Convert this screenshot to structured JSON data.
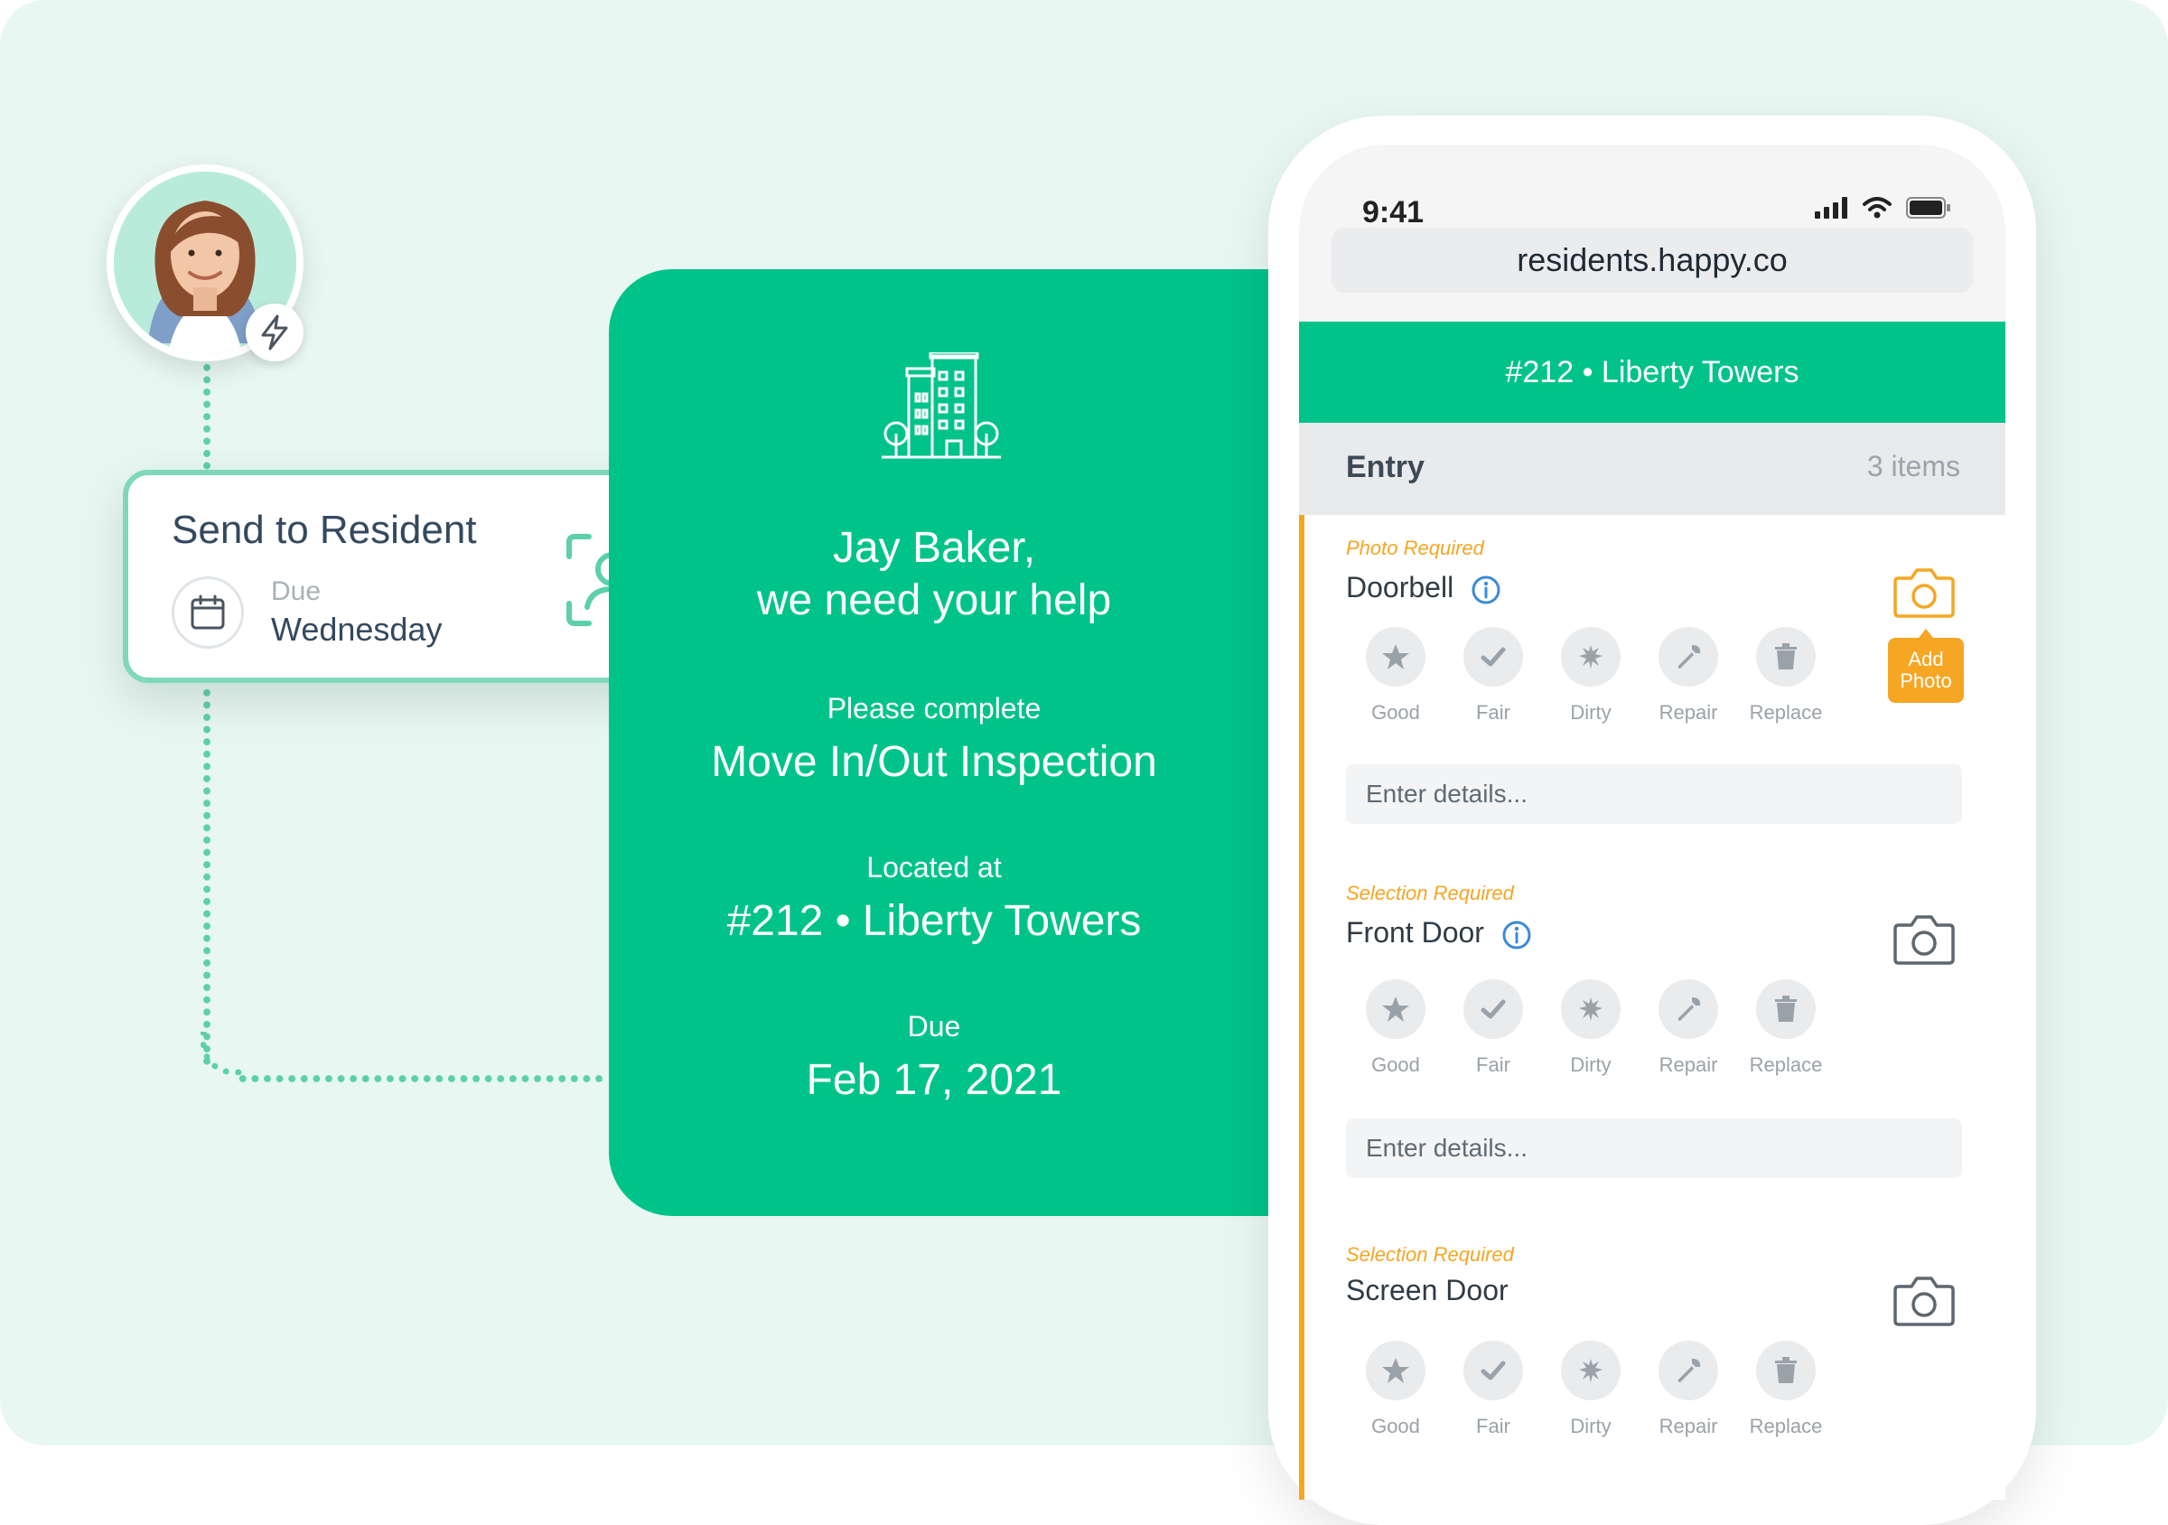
{
  "avatar": {
    "name": "resident-avatar"
  },
  "send_card": {
    "title": "Send to Resident",
    "due_label": "Due",
    "due_value": "Wednesday"
  },
  "invite": {
    "greeting_line1": "Jay Baker,",
    "greeting_line2": "we need your help",
    "task_label": "Please complete",
    "task_value": "Move In/Out Inspection",
    "location_label": "Located at",
    "location_value": "#212 • Liberty Towers",
    "due_label": "Due",
    "due_value": "Feb 17, 2021"
  },
  "phone": {
    "time": "9:41",
    "url": "residents.happy.co",
    "header": "#212 • Liberty Towers",
    "section": {
      "title": "Entry",
      "count": "3 items"
    },
    "conditions": [
      "Good",
      "Fair",
      "Dirty",
      "Repair",
      "Replace"
    ],
    "details_placeholder": "Enter details...",
    "add_photo": "Add Photo",
    "items": [
      {
        "requirement": "Photo Required",
        "name": "Doorbell"
      },
      {
        "requirement": "Selection Required",
        "name": "Front Door"
      },
      {
        "requirement": "Selection Required",
        "name": "Screen Door"
      }
    ]
  },
  "colors": {
    "brand_green": "#00c389",
    "accent_orange": "#f5a623",
    "background": "#e8f7f1"
  }
}
